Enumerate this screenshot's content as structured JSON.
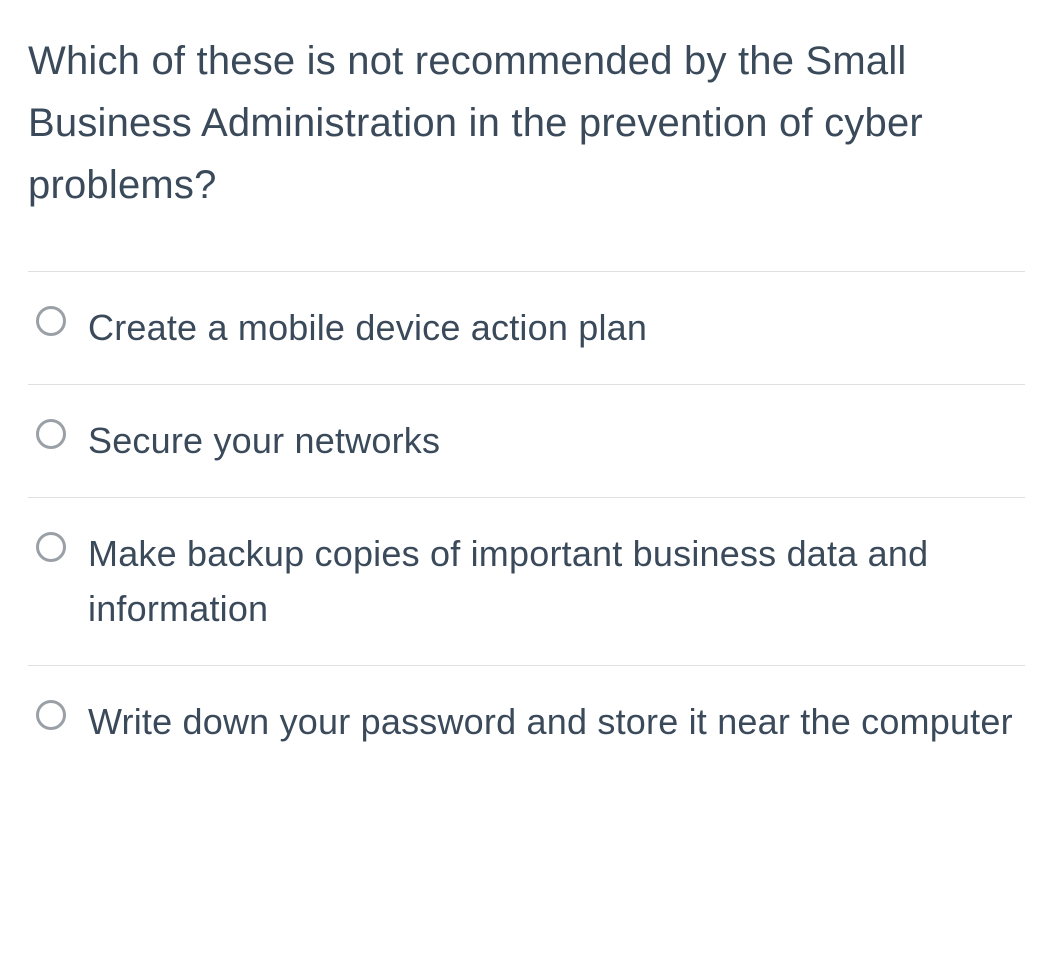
{
  "question": "Which of these is not recommended by the Small Business Administration in the prevention of cyber problems?",
  "options": [
    {
      "label": "Create a mobile device action plan"
    },
    {
      "label": "Secure your networks"
    },
    {
      "label": "Make backup copies of important business data and information"
    },
    {
      "label": "Write down your password and store it near the computer"
    }
  ]
}
